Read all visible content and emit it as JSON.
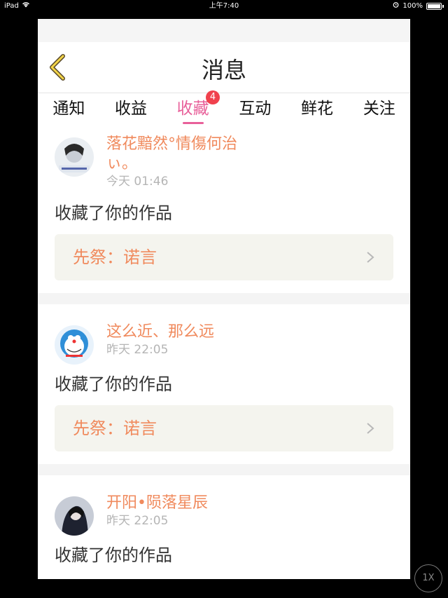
{
  "status_bar": {
    "device": "iPad",
    "time": "上午7:40",
    "battery": "100%"
  },
  "navbar": {
    "title": "消息"
  },
  "tabs": [
    {
      "label": "通知"
    },
    {
      "label": "收益"
    },
    {
      "label": "收藏",
      "badge": "4",
      "active": true
    },
    {
      "label": "互动"
    },
    {
      "label": "鲜花"
    },
    {
      "label": "关注"
    }
  ],
  "messages": [
    {
      "name": "落花黯然°情傷何治ぃ。",
      "time": "今天 01:46",
      "content": "收藏了你的作品",
      "work": "先祭：诺言"
    },
    {
      "name": "这么近、那么远",
      "time": "昨天 22:05",
      "content": "收藏了你的作品",
      "work": "先祭：诺言"
    },
    {
      "name": "开阳•陨落星辰",
      "time": "昨天 22:05",
      "content": "收藏了你的作品"
    }
  ],
  "zoom_badge": "1X",
  "colors": {
    "accent_pink": "#e8609a",
    "name_orange": "#f08a5d",
    "badge_red": "#f0414d"
  }
}
